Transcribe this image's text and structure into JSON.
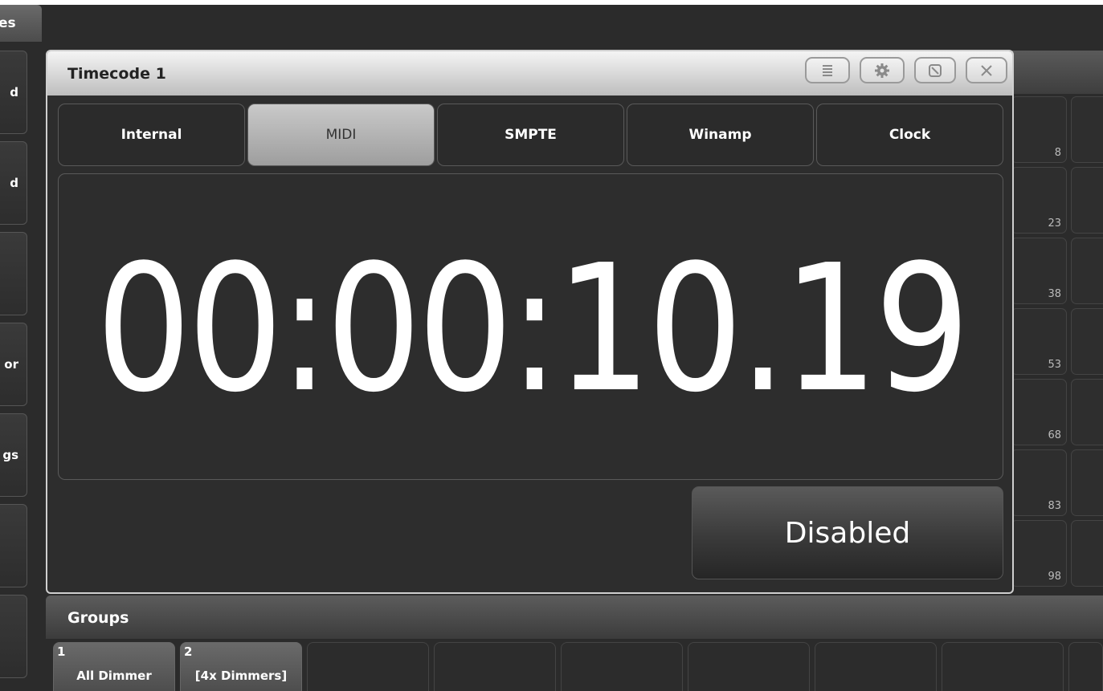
{
  "sidebar": {
    "tab_label": "es",
    "buttons": [
      "d",
      "d",
      "",
      "or",
      "gs",
      "",
      ""
    ]
  },
  "timecode_window": {
    "title": "Timecode 1",
    "tabs": [
      {
        "label": "Internal",
        "active": false
      },
      {
        "label": "MIDI",
        "active": true
      },
      {
        "label": "SMPTE",
        "active": false
      },
      {
        "label": "Winamp",
        "active": false
      },
      {
        "label": "Clock",
        "active": false
      }
    ],
    "time": "00:00:10.19",
    "status_button": "Disabled",
    "toolbar_icons": [
      "menu-icon",
      "gear-icon",
      "resize-icon",
      "close-icon"
    ]
  },
  "right_grid": {
    "numbers": [
      "8",
      "23",
      "38",
      "53",
      "68",
      "83",
      "98"
    ]
  },
  "groups": {
    "title": "Groups",
    "cells": [
      {
        "num": "1",
        "name": "All Dimmer"
      },
      {
        "num": "2",
        "name": "[4x Dimmers]"
      },
      {
        "num": "",
        "name": ""
      },
      {
        "num": "",
        "name": ""
      },
      {
        "num": "",
        "name": ""
      },
      {
        "num": "",
        "name": ""
      },
      {
        "num": "",
        "name": ""
      },
      {
        "num": "",
        "name": ""
      },
      {
        "num": "",
        "name": ""
      }
    ]
  }
}
